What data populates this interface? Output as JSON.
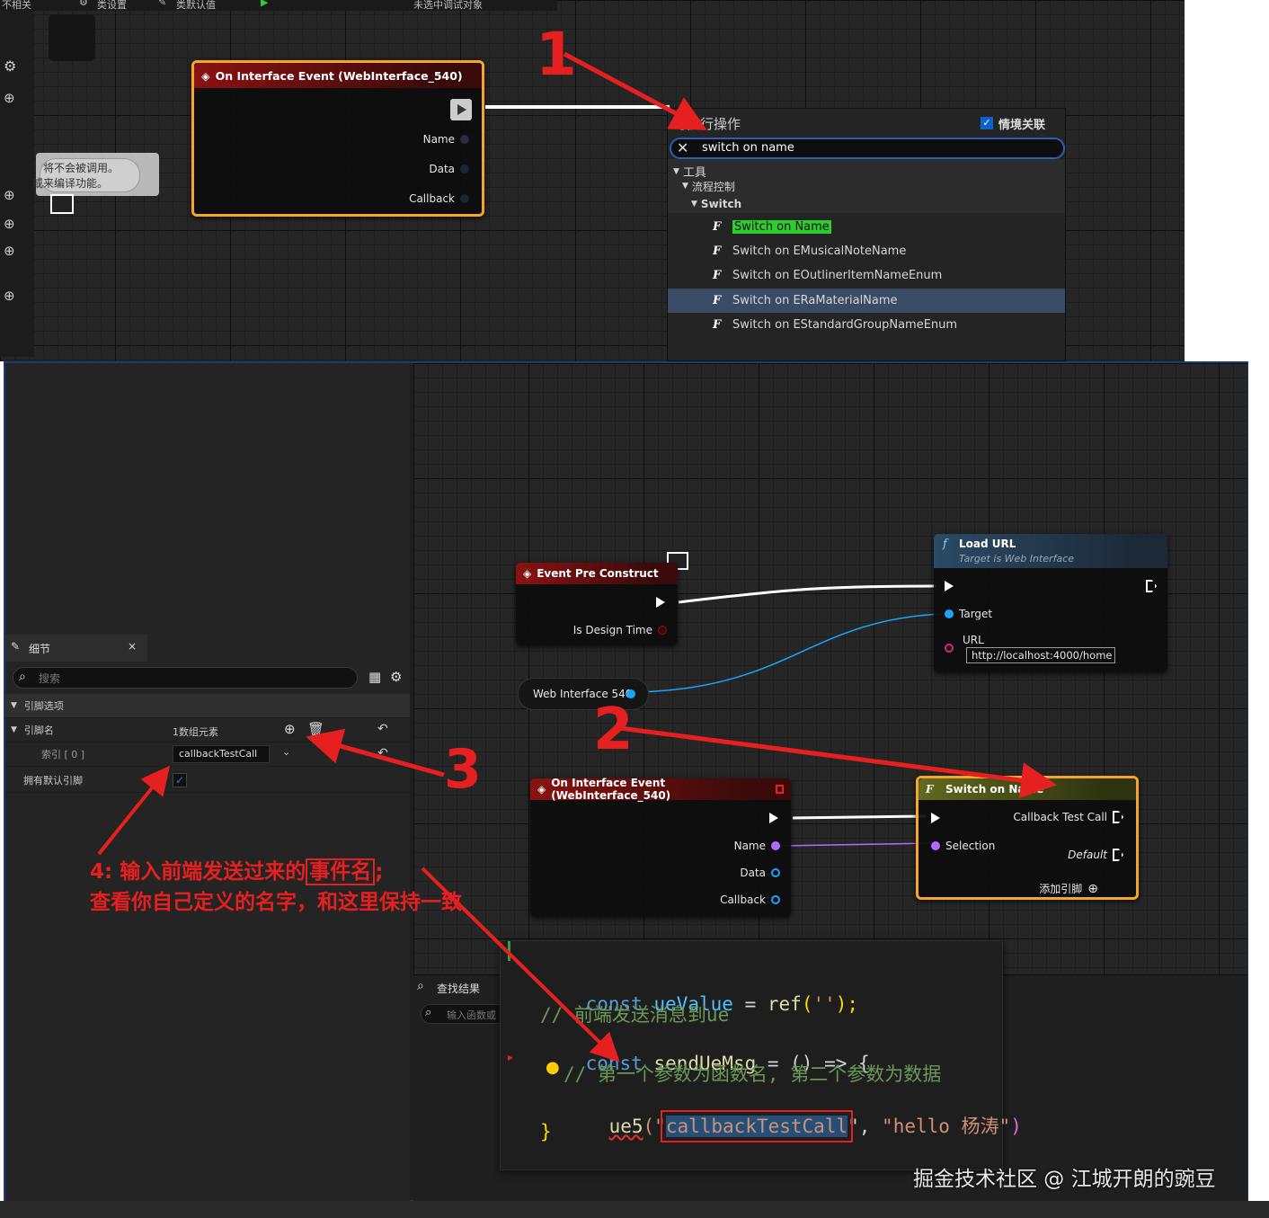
{
  "toolbar": {
    "item1": "不相关",
    "item2": "类设置",
    "item3": "类默认值",
    "debug": "未选中调试对象"
  },
  "top_graph": {
    "event_node": {
      "title": "On Interface Event (WebInterface_540)",
      "pins": [
        "Name",
        "Data",
        "Callback"
      ]
    },
    "comment_lines": [
      "将不会被调用。",
      "或来编译功能。"
    ],
    "action_menu": {
      "title": "可执行操作",
      "context_label": "情境关联",
      "search_value": "switch on name",
      "cat_tools": "工具",
      "cat_flow": "流程控制",
      "cat_switch": "Switch",
      "items": [
        "Switch on Name",
        "Switch on EMusicalNoteName",
        "Switch on EOutlinerItemNameEnum",
        "Switch on ERaMaterialName",
        "Switch on EStandardGroupNameEnum"
      ]
    }
  },
  "details": {
    "tab_title": "细节",
    "search_placeholder": "搜索",
    "section": "引脚选项",
    "row_pin_names": "引脚名",
    "row_pin_names_value": "1数组元素",
    "row_index": "索引 [ 0 ]",
    "row_index_value": "callbackTestCall",
    "row_default": "拥有默认引脚"
  },
  "bottom_graph": {
    "pre_construct": {
      "title": "Event Pre Construct",
      "pin": "Is Design Time"
    },
    "load_url": {
      "title": "Load URL",
      "subtitle": "Target is Web Interface",
      "pin_target": "Target",
      "pin_url": "URL",
      "url_value": "http://localhost:4000/home"
    },
    "web_var": "Web Interface 540",
    "event_node": {
      "title": "On Interface Event (WebInterface_540)",
      "pins": [
        "Name",
        "Data",
        "Callback"
      ]
    },
    "switch_node": {
      "title": "Switch on Name",
      "out1": "Callback Test Call",
      "selection": "Selection",
      "default": "Default",
      "add_pin": "添加引脚"
    }
  },
  "find_results": {
    "title": "查找结果",
    "placeholder": "输入函数或"
  },
  "code": {
    "line1": [
      "const ",
      "ueValue",
      " = ",
      "ref",
      "(",
      "''",
      ");"
    ],
    "line2": "// 前端发送消息到ue",
    "line3": [
      "const ",
      "sendUeMsg",
      " = () => {"
    ],
    "line4": "// 第一个参数为函数名, 第二个参数为数据",
    "line5": [
      "ue5",
      "(\"",
      "callbackTestCall",
      "\", ",
      "\"hello 杨涛\"",
      ")"
    ],
    "line6": "}"
  },
  "annotations": {
    "n1": "1",
    "n2": "2",
    "n3": "3",
    "note_line1_a": "4: 输入前端发送过来的",
    "note_line1_b": "事件名",
    "note_line1_c": ";",
    "note_line2": "查看你自己定义的名字，和这里保持一致"
  },
  "watermark": "掘金技术社区 @ 江城开朗的豌豆",
  "colors": {
    "accent_red": "#e62020",
    "selection_orange": "#f5a623",
    "highlight_green": "#2ecc2e",
    "pin_blue": "#1aa3ff",
    "pin_purple": "#b46aff",
    "pin_pink": "#e0208a"
  }
}
